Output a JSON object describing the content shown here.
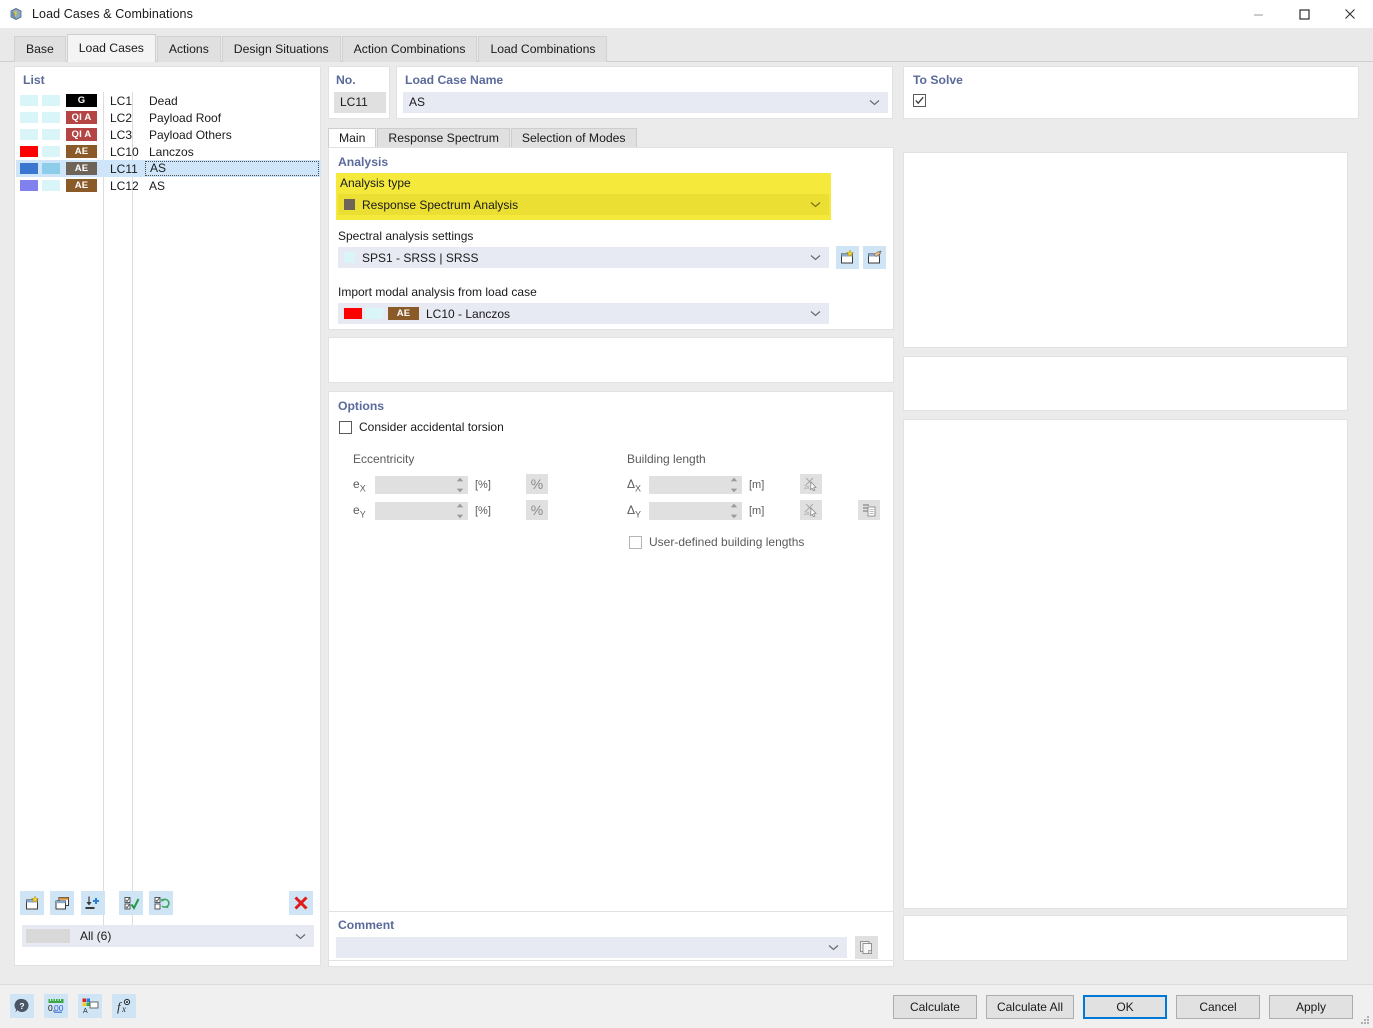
{
  "window": {
    "title": "Load Cases & Combinations",
    "icon": "app-cube-icon",
    "minimize": "—",
    "maximize": "□",
    "close": "✕"
  },
  "main_tabs": [
    {
      "label": "Base",
      "active": false
    },
    {
      "label": "Load Cases",
      "active": true
    },
    {
      "label": "Actions",
      "active": false
    },
    {
      "label": "Design Situations",
      "active": false
    },
    {
      "label": "Action Combinations",
      "active": false
    },
    {
      "label": "Load Combinations",
      "active": false
    }
  ],
  "list": {
    "title": "List",
    "rows": [
      {
        "no": "LC1",
        "name": "Dead",
        "badge": "G",
        "badge_bg": "#000000",
        "sw1": "#d9f5f7",
        "sw2": "#d9f5f7",
        "selected": false
      },
      {
        "no": "LC2",
        "name": "Payload Roof",
        "badge": "QI A",
        "badge_bg": "#b54545",
        "sw1": "#d9f5f7",
        "sw2": "#d9f5f7",
        "selected": false
      },
      {
        "no": "LC3",
        "name": "Payload Others",
        "badge": "QI A",
        "badge_bg": "#b54545",
        "sw1": "#d9f5f7",
        "sw2": "#d9f5f7",
        "selected": false
      },
      {
        "no": "LC10",
        "name": "Lanczos",
        "badge": "AE",
        "badge_bg": "#8a5a28",
        "sw1": "#ff0000",
        "sw2": "#d9f5f7",
        "selected": false
      },
      {
        "no": "LC11",
        "name": "AS",
        "badge": "AE",
        "badge_bg": "#6e6457",
        "sw1": "#3b76d1",
        "sw2": "#8ecdea",
        "selected": true
      },
      {
        "no": "LC12",
        "name": "AS",
        "badge": "AE",
        "badge_bg": "#8a5a28",
        "sw1": "#8080ef",
        "sw2": "#d9f5f7",
        "selected": false
      }
    ],
    "toolbar": [
      {
        "name": "new-load-case-button"
      },
      {
        "name": "copy-load-case-button"
      },
      {
        "name": "import-load-case-button"
      },
      {
        "name": "select-all-button"
      },
      {
        "name": "invert-selection-button"
      }
    ],
    "delete_button": "delete-load-case-button",
    "filter_value": "All (6)"
  },
  "header": {
    "no_label": "No.",
    "no_value": "LC11",
    "name_label": "Load Case Name",
    "name_value": "AS",
    "to_solve_label": "To Solve",
    "to_solve_checked": true
  },
  "inner_tabs": [
    {
      "label": "Main",
      "active": true
    },
    {
      "label": "Response Spectrum",
      "active": false
    },
    {
      "label": "Selection of Modes",
      "active": false
    }
  ],
  "analysis": {
    "section_label": "Analysis",
    "type_label": "Analysis type",
    "type_value": "Response Spectrum Analysis",
    "type_swatch": "#6e6457",
    "highlight_color": "#f5ea3c",
    "spectral_label": "Spectral analysis settings",
    "spectral_value": "SPS1 - SRSS | SRSS",
    "spectral_swatch": "#d9f5f7",
    "import_label": "Import modal analysis from load case",
    "import_value": "LC10 - Lanczos",
    "import_badge": "AE",
    "import_badge_bg": "#8a5a28",
    "import_sw1": "#ff0000",
    "import_sw2": "#d9f5f7"
  },
  "options": {
    "section_label": "Options",
    "accidental_torsion_label": "Consider accidental torsion",
    "accidental_torsion_checked": false,
    "eccentricity_label": "Eccentricity",
    "building_length_label": "Building length",
    "ex_label": "e",
    "ex_sub": "X",
    "ex_value": "",
    "ex_unit": "[%]",
    "ey_label": "e",
    "ey_sub": "Y",
    "ey_value": "",
    "ey_unit": "[%]",
    "dx_label": "Δ",
    "dx_sub": "X",
    "dx_value": "",
    "dx_unit": "[m]",
    "dy_label": "Δ",
    "dy_sub": "Y",
    "dy_value": "",
    "dy_unit": "[m]",
    "percent_glyph": "%",
    "user_defined_label": "User-defined building lengths",
    "user_defined_checked": false
  },
  "comment": {
    "label": "Comment",
    "value": ""
  },
  "footer": {
    "tools": [
      {
        "name": "help-icon"
      },
      {
        "name": "units-icon"
      },
      {
        "name": "display-properties-icon"
      },
      {
        "name": "formula-icon"
      }
    ],
    "buttons": [
      {
        "label": "Calculate",
        "primary": false
      },
      {
        "label": "Calculate All",
        "primary": false
      },
      {
        "label": "OK",
        "primary": true
      },
      {
        "label": "Cancel",
        "primary": false
      },
      {
        "label": "Apply",
        "primary": false
      }
    ]
  }
}
